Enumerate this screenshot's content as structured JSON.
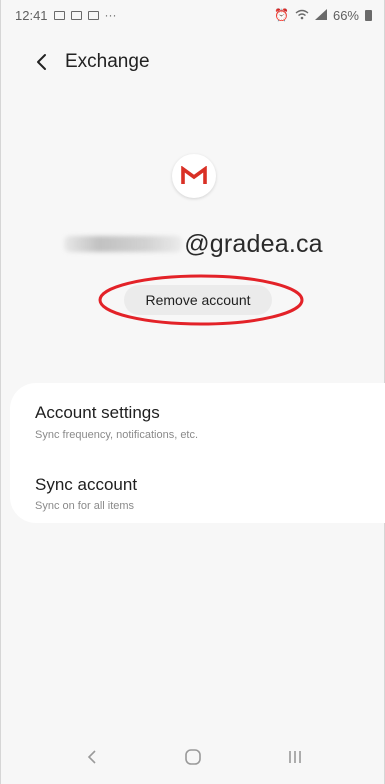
{
  "status_bar": {
    "time": "12:41",
    "more": "···",
    "battery": "66%"
  },
  "app_bar": {
    "title": "Exchange"
  },
  "account": {
    "email_domain": "@gradea.ca",
    "remove_label": "Remove account",
    "logo": "gmail-icon"
  },
  "settings": {
    "items": [
      {
        "title": "Account settings",
        "subtitle": "Sync frequency, notifications, etc."
      },
      {
        "title": "Sync account",
        "subtitle": "Sync on for all items"
      }
    ]
  },
  "nav": {
    "back": "chevron-left-icon",
    "home": "home-icon",
    "recents": "recents-icon"
  },
  "colors": {
    "highlight": "#e32228",
    "gmail_red": "#d93025"
  }
}
